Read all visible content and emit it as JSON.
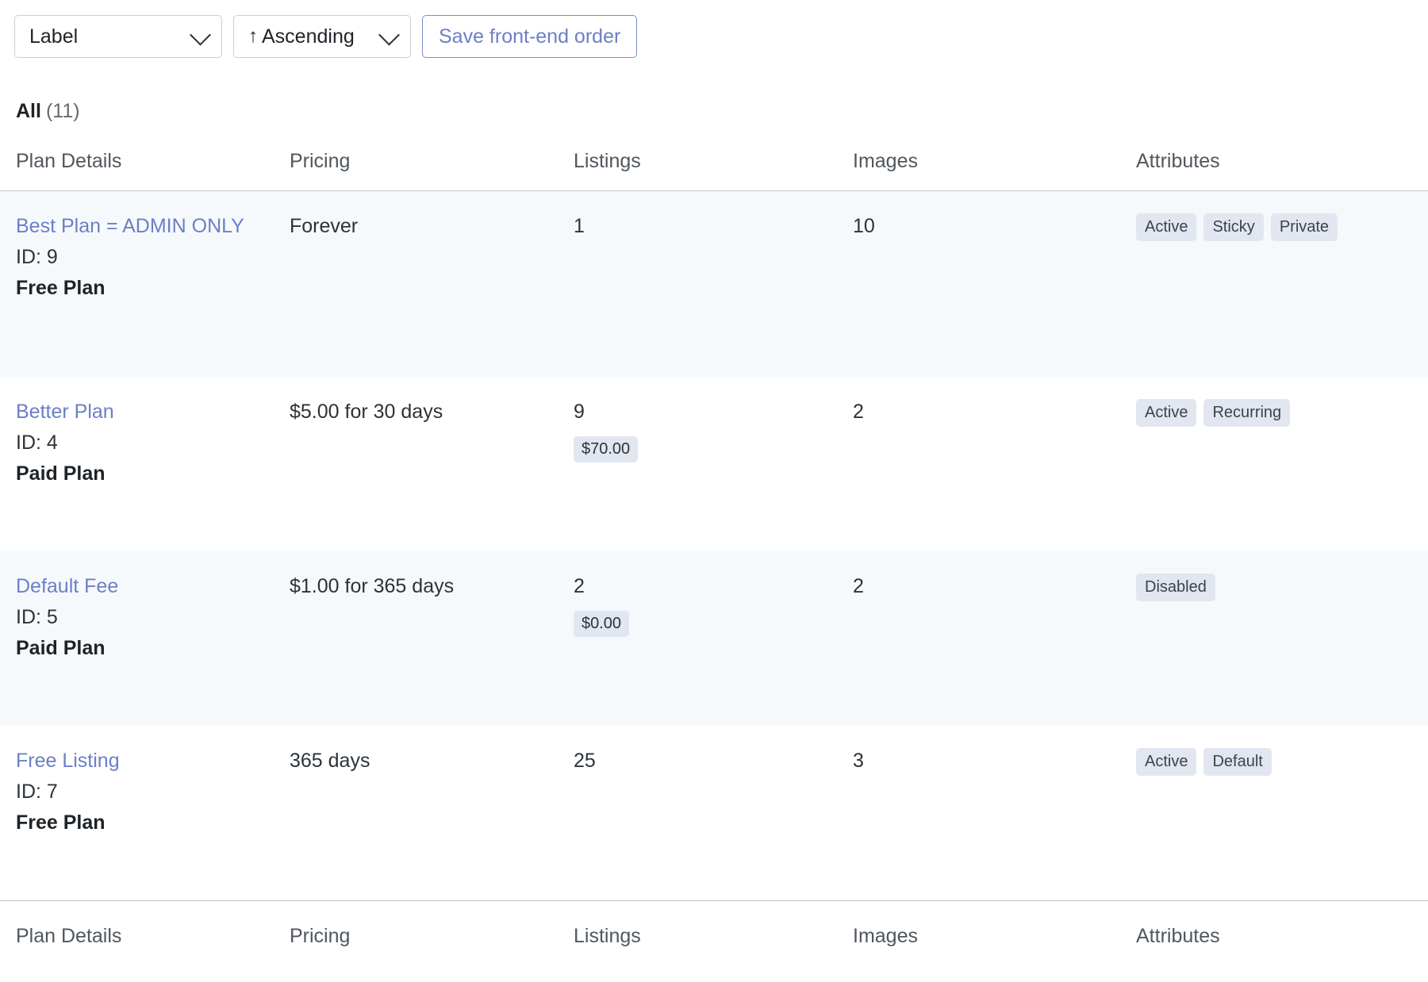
{
  "toolbar": {
    "sort_field": {
      "value": "Label",
      "caret_icon": "chevron-down-icon"
    },
    "sort_order": {
      "arrow": "↑",
      "value": "Ascending",
      "caret_icon": "chevron-down-icon"
    },
    "save_button": "Save front-end order"
  },
  "list": {
    "filter_label": "All",
    "filter_count": "(11)"
  },
  "table": {
    "columns": [
      "Plan Details",
      "Pricing",
      "Listings",
      "Images",
      "Attributes"
    ],
    "rows": [
      {
        "plan_title": "Best Plan = ADMIN ONLY",
        "plan_id": "ID: 9",
        "plan_type": "Free Plan",
        "pricing": "Forever",
        "listings": "1",
        "listings_money": "",
        "images": "10",
        "attributes": [
          "Active",
          "Sticky",
          "Private"
        ]
      },
      {
        "plan_title": "Better Plan",
        "plan_id": "ID: 4",
        "plan_type": "Paid Plan",
        "pricing": "$5.00 for 30 days",
        "listings": "9",
        "listings_money": "$70.00",
        "images": "2",
        "attributes": [
          "Active",
          "Recurring"
        ]
      },
      {
        "plan_title": "Default Fee",
        "plan_id": "ID: 5",
        "plan_type": "Paid Plan",
        "pricing": "$1.00 for 365 days",
        "listings": "2",
        "listings_money": "$0.00",
        "images": "2",
        "attributes": [
          "Disabled"
        ]
      },
      {
        "plan_title": "Free Listing",
        "plan_id": "ID: 7",
        "plan_type": "Free Plan",
        "pricing": "365 days",
        "listings": "25",
        "listings_money": "",
        "images": "3",
        "attributes": [
          "Active",
          "Default"
        ]
      }
    ]
  },
  "colors": {
    "link": "#6b7fc7",
    "badge_bg": "#e2e6f0",
    "stripe_bg": "#f6f9fc",
    "border": "#c3c4c7",
    "button_border": "#7a8fc9"
  }
}
